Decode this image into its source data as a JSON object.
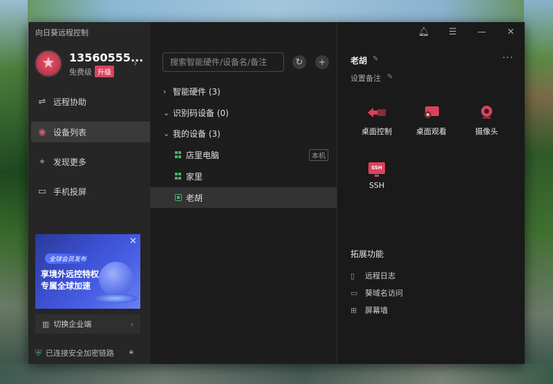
{
  "app": {
    "title": "向日葵远程控制"
  },
  "user": {
    "name": "13560555...",
    "plan": "免费级",
    "upgrade": "升级"
  },
  "nav": [
    {
      "label": "远程协助",
      "icon": "link-icon"
    },
    {
      "label": "设备列表",
      "icon": "device-list-icon"
    },
    {
      "label": "发现更多",
      "icon": "satellite-icon"
    },
    {
      "label": "手机投屏",
      "icon": "cast-icon"
    }
  ],
  "banner": {
    "tag": "全球会员发布",
    "line1": "享境外远控特权",
    "line2": "专属全球加速"
  },
  "enterprise": {
    "label": "切换企业端"
  },
  "security": {
    "label": "已连接安全加密链路"
  },
  "search": {
    "placeholder": "搜索智能硬件/设备名/备注"
  },
  "tree": {
    "groups": [
      {
        "label": "智能硬件 (3)",
        "expanded": false
      },
      {
        "label": "识别码设备 (0)",
        "expanded": true
      },
      {
        "label": "我的设备 (3)",
        "expanded": true
      }
    ],
    "devices": [
      {
        "name": "店里电脑",
        "tag": "本机",
        "os": "windows"
      },
      {
        "name": "家里",
        "tag": "",
        "os": "windows"
      },
      {
        "name": "老胡",
        "tag": "",
        "os": "other",
        "selected": true
      }
    ]
  },
  "detail": {
    "name": "老胡",
    "remark": "设置备注",
    "actions": [
      {
        "label": "桌面控制",
        "icon": "desktop-control-icon"
      },
      {
        "label": "桌面观看",
        "icon": "desktop-view-icon"
      },
      {
        "label": "摄像头",
        "icon": "camera-icon"
      },
      {
        "label": "SSH",
        "icon": "ssh-icon",
        "badge": "SSH"
      }
    ],
    "extensions_title": "拓展功能",
    "extensions": [
      {
        "label": "远程日志",
        "icon": "log-icon"
      },
      {
        "label": "葵域名访问",
        "icon": "domain-icon"
      },
      {
        "label": "屏幕墙",
        "icon": "grid-icon"
      }
    ]
  },
  "colors": {
    "accent": "#d9435c",
    "online": "#43b66a",
    "secure": "#3fbf73",
    "window_bg": "#1a1a1a"
  }
}
